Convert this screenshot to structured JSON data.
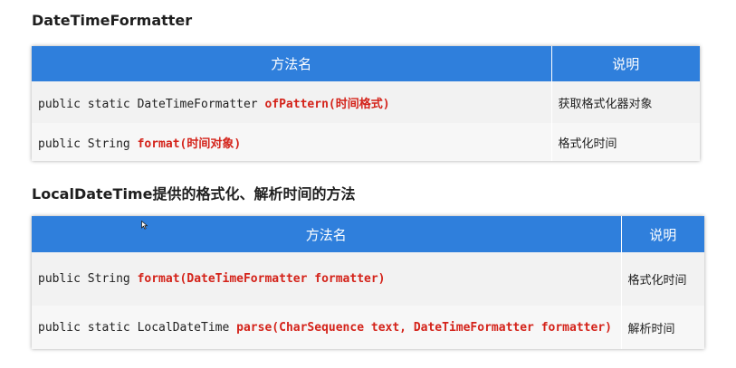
{
  "section1": {
    "heading": "DateTimeFormatter",
    "columns": [
      "方法名",
      "说明"
    ],
    "rows": [
      {
        "code_prefix": "public static DateTimeFormatter ",
        "code_method": "ofPattern(时间格式)",
        "description": "获取格式化器对象"
      },
      {
        "code_prefix": "public String ",
        "code_method": "format(时间对象)",
        "description": "格式化时间"
      }
    ]
  },
  "section2": {
    "heading": "LocalDateTime提供的格式化、解析时间的方法",
    "columns": [
      "方法名",
      "说明"
    ],
    "rows": [
      {
        "code_prefix": "public String ",
        "code_method": "format(DateTimeFormatter formatter)",
        "description": "格式化时间"
      },
      {
        "code_prefix": "public static LocalDateTime ",
        "code_method": "parse(CharSequence text, DateTimeFormatter formatter)",
        "description": "解析时间"
      }
    ]
  },
  "colors": {
    "header_bg": "#2f7fdc",
    "method_highlight": "#d4231a"
  }
}
